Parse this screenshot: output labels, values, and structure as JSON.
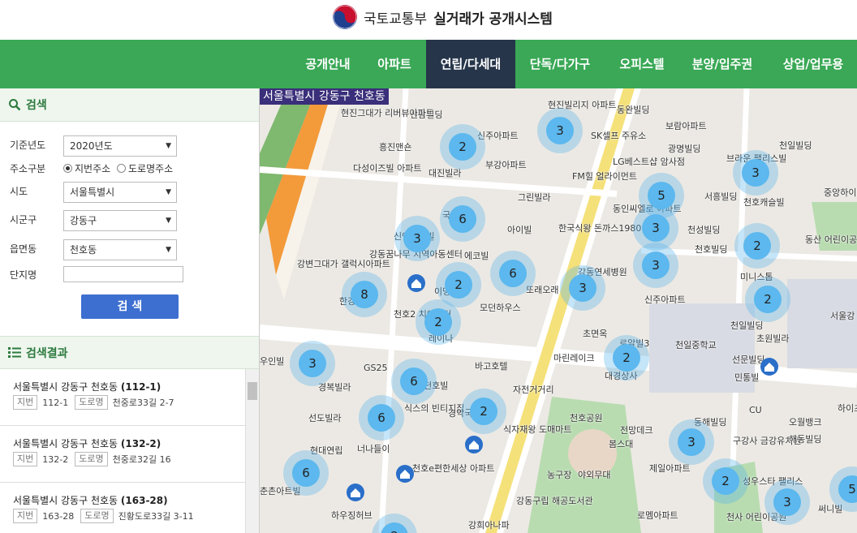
{
  "header": {
    "ministry": "국토교통부",
    "system": "실거래가 공개시스템"
  },
  "nav": [
    {
      "label": "공개안내",
      "active": false
    },
    {
      "label": "아파트",
      "active": false
    },
    {
      "label": "연립/다세대",
      "active": true
    },
    {
      "label": "단독/다가구",
      "active": false
    },
    {
      "label": "오피스텔",
      "active": false
    },
    {
      "label": "분양/입주권",
      "active": false
    },
    {
      "label": "상업/업무용",
      "active": false
    }
  ],
  "search": {
    "title": "검색",
    "year_label": "기준년도",
    "year_value": "2020년도",
    "addr_type_label": "주소구분",
    "addr_opt1": "지번주소",
    "addr_opt2": "도로명주소",
    "sido_label": "시도",
    "sido_value": "서울특별시",
    "sigungu_label": "시군구",
    "sigungu_value": "강동구",
    "dong_label": "읍면동",
    "dong_value": "천호동",
    "complex_label": "단지명",
    "complex_value": "",
    "button": "검 색"
  },
  "results": {
    "title": "검색결과",
    "items": [
      {
        "title": "서울특별시 강동구 천호동",
        "code": "(112-1)",
        "jibun_tag": "지번",
        "jibun": "112-1",
        "road_tag": "도로명",
        "road": "천중로33길 2-7"
      },
      {
        "title": "서울특별시 강동구 천호동",
        "code": "(132-2)",
        "jibun_tag": "지번",
        "jibun": "132-2",
        "road_tag": "도로명",
        "road": "천중로32길 16"
      },
      {
        "title": "서울특별시 강동구 천호동",
        "code": "(163-28)",
        "jibun_tag": "지번",
        "jibun": "163-28",
        "road_tag": "도로명",
        "road": "진황도로33길 3-11"
      }
    ]
  },
  "map": {
    "region": "서울특별시 강동구 천호동",
    "pois": [
      "신암빌딩",
      "현진빌리지 아파트",
      "동완빌딩",
      "현진그대가 리버뷰아파트",
      "SK셀프 주유소",
      "보람아파트",
      "흥진맨숀",
      "신주아파트",
      "광명빌딩",
      "대진빌라",
      "부강아파트",
      "LG베스트샵 암사점",
      "브라운 팰리스빌",
      "천일빌딩",
      "다성이즈빌 아파트",
      "FM힐 얼라이먼트",
      "그린빌라",
      "동인씨엘로 아파트",
      "서흥빌딩",
      "천호캐슬빌",
      "중앙하이 아파트",
      "국도맨션",
      "한국식왕 돈까스1980",
      "아이빌",
      "천성빌딩",
      "동산 어린이공원",
      "신안아이빌",
      "에코빌",
      "강동꿈나무 지역아동센터",
      "천호빌딩",
      "강변그대가 갤럭시아파트",
      "강동연세병원",
      "미니스톱",
      "이명빌",
      "또래오래",
      "한강빌",
      "모던하우스",
      "신주아파트",
      "천호2 치안센터",
      "초면옥",
      "서울강 초등학",
      "레이나",
      "천일빌딩",
      "초원빌라",
      "마린레이크",
      "천일중학교",
      "로알빌3",
      "바고호텔",
      "선문빌딩",
      "대경상사",
      "우인빌",
      "GS25",
      "민통빌",
      "경복빌라",
      "천호빌",
      "자전거거리",
      "식스의 빈티지집",
      "경악국",
      "CU",
      "하이츠빌",
      "선도빌라",
      "천호공원",
      "동해빌딩",
      "오월뱅크",
      "식자재왕 도매마트",
      "전망데크",
      "현대연립",
      "너나들이",
      "봄스대",
      "구강사 금강유치원",
      "해동빌딩",
      "천호e편한세상 아파트",
      "농구장",
      "야외무대",
      "제일아파트",
      "춘촌아트빌",
      "성우스타 팰리스",
      "강동구립 해공도서관",
      "천사 어린이공원",
      "하우징허브",
      "로멤아파트",
      "강희아나파",
      "써니빌"
    ],
    "clusters": [
      3,
      2,
      5,
      3,
      6,
      2,
      3,
      2,
      6,
      3,
      3,
      8,
      2,
      2,
      3,
      2,
      6,
      2,
      6,
      3,
      6,
      3,
      2,
      3,
      5,
      2
    ]
  }
}
